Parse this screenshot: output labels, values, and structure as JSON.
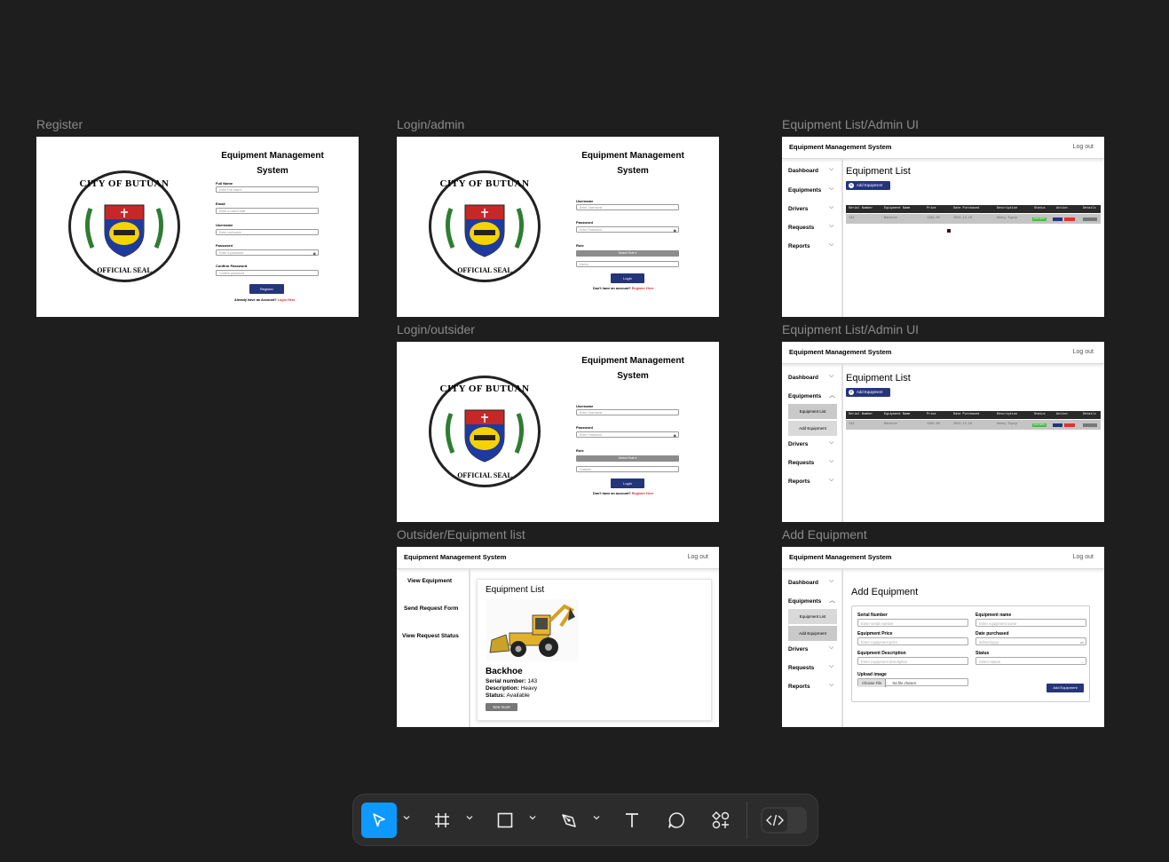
{
  "canvas": {
    "frame_labels": {
      "register": "Register",
      "login_admin": "Login/admin",
      "login_outsider": "Login/outsider",
      "outsider_list": "Outsider/Equipment list",
      "equip_admin_1": "Equipment List/Admin UI",
      "equip_admin_2": "Equipment List/Admin UI",
      "add_equipment": "Add Equipment"
    }
  },
  "seal": {
    "top_text": "CITY OF BUTUAN",
    "bottom_text": "OFFICIAL SEAL"
  },
  "register": {
    "title_line1": "Equipment Management",
    "title_line2": "System",
    "full_name_label": "Full Name",
    "full_name_ph": "Enter Full Name",
    "email_label": "Email",
    "email_ph": "Enter a valid Email",
    "username_label": "Username",
    "username_ph": "Enter username",
    "password_label": "Password",
    "password_ph": "Enter a password",
    "confirm_label": "Confirm Password",
    "confirm_ph": "Confirm password",
    "button": "Register",
    "footer_text": "Already have an Account?",
    "footer_link": "Login Here"
  },
  "login_admin": {
    "title_line1": "Equipment Management",
    "title_line2": "System",
    "username_label": "Username",
    "username_ph": "Enter Username",
    "password_label": "Password",
    "password_ph": "Enter Password",
    "role_label": "Role",
    "select_role": "Select Role ▾",
    "role_value": "Admin",
    "button": "Login",
    "footer_text": "Don't have an account?",
    "footer_link": "Register Here"
  },
  "login_outsider": {
    "title_line1": "Equipment Management",
    "title_line2": "System",
    "username_label": "Username",
    "username_ph": "Enter Username",
    "password_label": "Password",
    "password_ph": "Enter Password",
    "role_label": "Role",
    "select_role": "Select Role ▾",
    "role_value": "Outsider",
    "button": "Login",
    "footer_text": "Don't have an account?",
    "footer_link": "Register Here"
  },
  "admin": {
    "app_title": "Equipment Management System",
    "logout": "Log out",
    "nav": {
      "dashboard": "Dashboard",
      "equipments": "Equipments",
      "drivers": "Drivers",
      "requests": "Requests",
      "reports": "Reports"
    },
    "sub": {
      "equipment_list": "Equipment List",
      "add_equipment": "Add Equipment"
    },
    "page_title": "Equipment List",
    "add_button": "Add Equipment",
    "table": {
      "headers": [
        "Serial Number",
        "Equipment Name",
        "Price",
        "Date Purchased",
        "Description",
        "Status",
        "Action",
        "Details"
      ],
      "row": [
        "143",
        "Backhoe",
        "1299.00",
        "2024-12-18",
        "Heavy Equip",
        "Available",
        "Edit",
        "Delete",
        "See more"
      ]
    }
  },
  "outsider": {
    "app_title": "Equipment Management System",
    "logout": "Log out",
    "nav": {
      "view": "View Equipment",
      "send": "Send Request Form",
      "status": "View Request Status"
    },
    "card_title": "Equipment List",
    "item_name": "Backhoe",
    "serial_label": "Serial number:",
    "serial_value": "143",
    "desc_label": "Description:",
    "desc_value": "Heavy",
    "status_label": "Status:",
    "status_value": "Available",
    "see_more": "See more"
  },
  "add_form": {
    "page_title": "Add Equipment",
    "serial_label": "Serial Number",
    "serial_ph": "Enter serial number",
    "name_label": "Equipment name",
    "name_ph": "Enter equipment name",
    "price_label": "Equipment Price",
    "price_ph": "Enter equipment price",
    "date_label": "Date purchased",
    "date_ph": "dd/mm/yyyy",
    "desc_label": "Equipment Description",
    "desc_ph": "Enter equipment description",
    "status_label": "Status",
    "status_ph": "Select status",
    "upload_label": "Upload image",
    "choose_file": "Choose File",
    "no_file": "No file chosen",
    "submit": "Add Equipment"
  },
  "colors": {
    "canvas_bg": "#1e1e1e",
    "primary": "#24357a",
    "active_tool": "#0d99ff",
    "link_red": "#d32f2f",
    "status_green": "#3cc23c"
  },
  "toolbar": {
    "tools": [
      "move-icon",
      "frame-icon",
      "rectangle-icon",
      "pen-icon",
      "text-icon",
      "comment-icon",
      "actions-icon",
      "dev-mode-icon"
    ],
    "active": "move-icon"
  }
}
